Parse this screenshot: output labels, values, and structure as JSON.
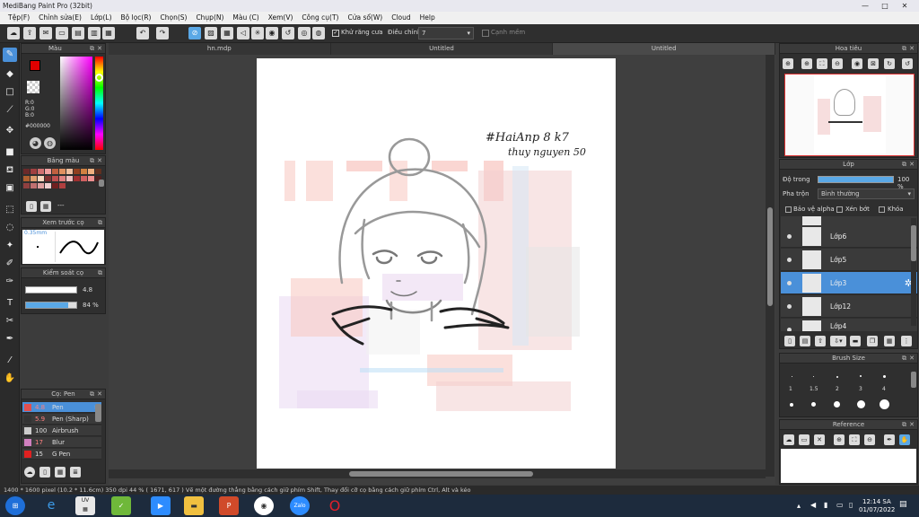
{
  "titlebar": {
    "title": "MediBang Paint Pro (32bit)",
    "minimize": "—",
    "maximize": "□",
    "close": "✕"
  },
  "menu": [
    "Tệp(F)",
    "Chỉnh sửa(E)",
    "Lớp(L)",
    "Bộ lọc(R)",
    "Chọn(S)",
    "Chụp(N)",
    "Màu (C)",
    "Xem(V)",
    "Công cụ(T)",
    "Cửa sổ(W)",
    "Cloud",
    "Help"
  ],
  "toolbar": {
    "antialias_label": "Khử răng cưa",
    "adjust_label": "Điều chỉnh",
    "adjust_value": "7",
    "soft_edge_label": "Cạnh mềm"
  },
  "tabs": [
    "hn.mdp",
    "Untitled",
    "Untitled"
  ],
  "color_panel": {
    "title": "Màu",
    "r": "R:0",
    "g": "G:0",
    "b": "B:0",
    "hex": "#000000",
    "fg": "#e00000",
    "bg": "#ffffff"
  },
  "palette_panel": {
    "title": "Bảng màu",
    "extra": "---"
  },
  "preview_panel": {
    "title": "Xem trước cọ",
    "size": "0.35mm"
  },
  "brush_control": {
    "title": "Kiểm soát cọ",
    "size_value": "4.8",
    "opacity_value": "84 %",
    "size_fraction": 0.95,
    "opacity_fraction": 0.84
  },
  "brush_list": {
    "title": "Cọ: Pen",
    "items": [
      {
        "size": "4.8",
        "name": "Pen",
        "color": "#e05050"
      },
      {
        "size": "5.9",
        "name": "Pen (Sharp)",
        "color": "#333333"
      },
      {
        "size": "100",
        "name": "Airbrush",
        "color": "#cccccc"
      },
      {
        "size": "17",
        "name": "Blur",
        "color": "#d080c0"
      },
      {
        "size": "15",
        "name": "G Pen",
        "color": "#e02020"
      }
    ]
  },
  "canvas": {
    "signature_line1": "#HaiAnp 8 k7",
    "signature_line2": "thuy nguyen 50"
  },
  "navigator": {
    "title": "Hoa tiêu"
  },
  "layers": {
    "title": "Lớp",
    "opacity_label": "Độ trong",
    "opacity_value": "100 %",
    "opacity_fraction": 1.0,
    "blend_label": "Pha trộn",
    "blend_value": "Bình thường",
    "protect_alpha": "Bảo vệ alpha",
    "clip": "Xén bớt",
    "lock": "Khóa",
    "items": [
      {
        "name": "Lớp6"
      },
      {
        "name": "Lớp5"
      },
      {
        "name": "Lớp3"
      },
      {
        "name": "Lớp12"
      },
      {
        "name": "Lớp4"
      }
    ]
  },
  "brush_size": {
    "title": "Brush Size",
    "labels": [
      "1",
      "1.5",
      "2",
      "3",
      "4"
    ]
  },
  "reference": {
    "title": "Reference"
  },
  "status": {
    "text": "1400 * 1600 pixel  (10.2 * 11.6cm)  350 dpi  44 %  ( 1671, 617 )  Vẽ một đường thẳng bằng cách giữ phím Shift, Thay đổi cỡ cọ bằng cách giữ phím Ctrl, Alt và kéo"
  },
  "taskbar": {
    "time": "12:14 SA",
    "date": "01/07/2022",
    "zalo": "Zalo"
  }
}
